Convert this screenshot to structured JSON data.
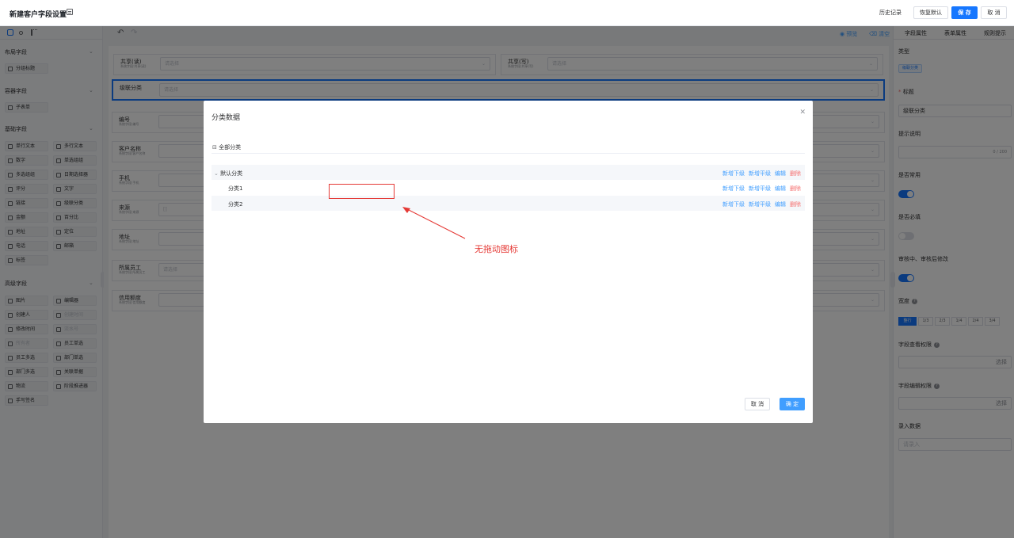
{
  "topbar": {
    "title": "新建客户字段设置",
    "history": "历史记录",
    "restore": "恢复默认",
    "save": "保 存",
    "cancel": "取 消"
  },
  "left": {
    "sections": [
      "布局字段",
      "容器字段",
      "基础字段",
      "高级字段"
    ],
    "layout_items": [
      "分组标题"
    ],
    "container_items": [
      "子表单"
    ],
    "basic_items": [
      "单行文本",
      "多行文本",
      "数字",
      "单选组组",
      "多选组组",
      "日期选择器",
      "评分",
      "文字",
      "链接",
      "级联分类",
      "金额",
      "百分比",
      "地址",
      "定位",
      "电话",
      "邮箱",
      "标签"
    ],
    "advanced_items": [
      "图片",
      "编辑器",
      "创建人",
      "创建时间",
      "修改时间",
      "流水号",
      "所有者",
      "员工单选",
      "员工多选",
      "部门单选",
      "部门多选",
      "关联单据",
      "物流",
      "阶段推进器",
      "手写签名"
    ],
    "advanced_disabled": [
      false,
      false,
      false,
      true,
      false,
      true,
      true,
      false,
      false,
      false,
      false,
      false,
      false,
      false,
      false
    ]
  },
  "canvas": {
    "preview": "预览",
    "clear": "清空",
    "fields": [
      {
        "label": "共享(读)",
        "sub": "系统字段:共享(读)",
        "placeholder": "请选择"
      },
      {
        "label": "共享(写)",
        "sub": "系统字段:共享(写)",
        "placeholder": "请选择"
      },
      {
        "label": "级联分类",
        "sub": "",
        "placeholder": "请选择"
      },
      {
        "label": "编号",
        "sub": "系统字段:编号",
        "placeholder": ""
      },
      {
        "label": "客户名称",
        "sub": "系统字段:客户名称",
        "placeholder": ""
      },
      {
        "label": "手机",
        "sub": "系统字段:手机",
        "placeholder": ""
      },
      {
        "label": "来源",
        "sub": "系统字段:来源",
        "placeholder": "[]"
      },
      {
        "label": "地址",
        "sub": "系统字段:地址",
        "placeholder": ""
      },
      {
        "label": "所属员工",
        "sub": "系统字段:所属员工",
        "placeholder": "请选择"
      },
      {
        "label": "信用额度",
        "sub": "系统字段:信用额度",
        "placeholder": ""
      }
    ]
  },
  "right": {
    "tabs": [
      "字段属性",
      "表单属性",
      "规则提示"
    ],
    "type_label": "类型",
    "type_value": "级联分类",
    "title_label": "标题",
    "title_value": "级联分类",
    "hint_label": "提示说明",
    "hint_count": "0 / 200",
    "common_label": "是否常用",
    "required_label": "是否必填",
    "edit_label": "审核中、审核后修改",
    "width_label": "宽度",
    "width_options": [
      "整行",
      "1/3",
      "2/3",
      "1/4",
      "2/4",
      "3/4"
    ],
    "view_perm_label": "字段查看权限",
    "view_perm_btn": "选择",
    "edit_perm_label": "字段编辑权限",
    "edit_perm_btn": "选择",
    "input_data_label": "录入数据",
    "input_data_placeholder": "请录入"
  },
  "modal": {
    "title": "分类数据",
    "root": "全部分类",
    "rows": [
      {
        "name": "默认分类",
        "level": 0
      },
      {
        "name": "分类1",
        "level": 1
      },
      {
        "name": "分类2",
        "level": 1
      }
    ],
    "actions": {
      "add_child": "新增下级",
      "add_sibling": "新增平级",
      "edit": "编辑",
      "delete": "删除"
    },
    "cancel": "取 消",
    "ok": "确 定"
  },
  "annotation": "无拖动图标",
  "colors": {
    "primary": "#1677ff",
    "link": "#409eff",
    "danger": "#f56c6c",
    "annotation": "#e53935"
  }
}
